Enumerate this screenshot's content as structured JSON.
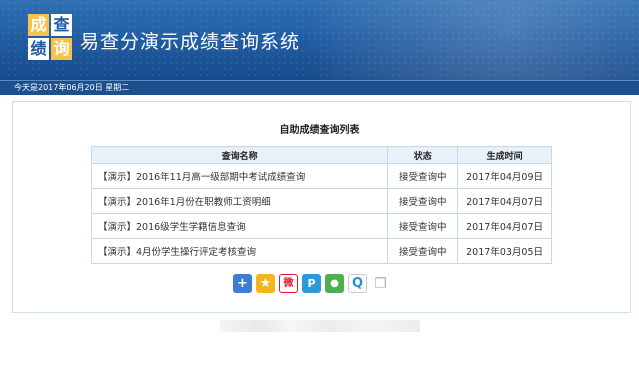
{
  "header": {
    "logo_chars": [
      "成",
      "查",
      "绩",
      "询"
    ],
    "title": "易查分演示成绩查询系统"
  },
  "datebar": {
    "text": "今天是2017年06月20日 星期二"
  },
  "list": {
    "title": "自助成绩查询列表",
    "columns": [
      "查询名称",
      "状态",
      "生成时间"
    ],
    "rows": [
      {
        "name": "【演示】2016年11月高一级部期中考试成绩查询",
        "status": "接受查询中",
        "date": "2017年04月09日"
      },
      {
        "name": "【演示】2016年1月份在职教师工资明细",
        "status": "接受查询中",
        "date": "2017年04月07日"
      },
      {
        "name": "【演示】2016级学生学籍信息查询",
        "status": "接受查询中",
        "date": "2017年04月07日"
      },
      {
        "name": "【演示】4月份学生操行评定考核查询",
        "status": "接受查询中",
        "date": "2017年03月05日"
      }
    ]
  },
  "share_icons": [
    {
      "icon": "plus-icon",
      "color": "#3b7fd4",
      "glyph": "+"
    },
    {
      "icon": "qzone-star-icon",
      "color": "#f2b51c",
      "glyph": "★"
    },
    {
      "icon": "weibo-icon",
      "color": "#e6162d",
      "glyph": "微"
    },
    {
      "icon": "tencent-weibo-icon",
      "color": "#2f9ad9",
      "glyph": "P"
    },
    {
      "icon": "wechat-icon",
      "color": "#4caf50",
      "glyph": "●"
    },
    {
      "icon": "qq-icon",
      "color": "#2a8be0",
      "glyph": "Q"
    },
    {
      "icon": "copy-icon",
      "color": "#d7d7d7",
      "glyph": "❐"
    }
  ]
}
